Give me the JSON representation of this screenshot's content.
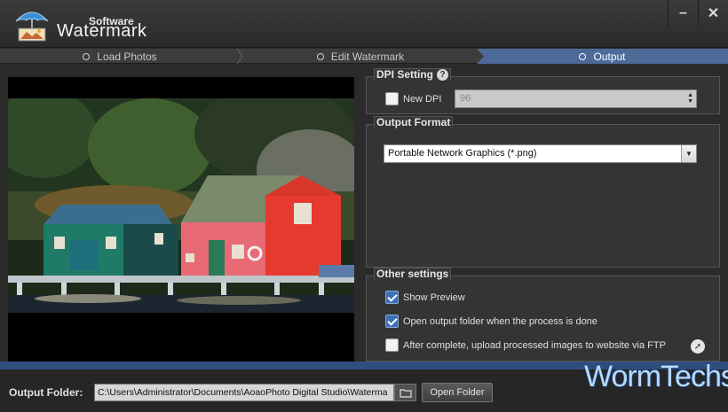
{
  "app": {
    "subtitle": "Software",
    "title": "Watermark"
  },
  "window": {
    "minimize": "–",
    "close": "✕"
  },
  "steps": [
    {
      "label": "Load Photos",
      "active": false
    },
    {
      "label": "Edit Watermark",
      "active": false
    },
    {
      "label": "Output",
      "active": true
    }
  ],
  "dpi": {
    "title": "DPI Setting",
    "help": "?",
    "checkbox_label": "New DPI",
    "checked": false,
    "value": "96"
  },
  "format": {
    "title": "Output Format",
    "selected": "Portable Network Graphics (*.png)"
  },
  "other": {
    "title": "Other settings",
    "options": [
      {
        "label": "Show Preview",
        "checked": true
      },
      {
        "label": "Open output folder when the process is done",
        "checked": true
      },
      {
        "label": "After complete, upload processed images to website via FTP",
        "checked": false
      }
    ]
  },
  "footer": {
    "output_label": "Output Folder:",
    "output_path": "C:\\Users\\Administrator\\Documents\\AoaoPhoto Digital Studio\\Waterma",
    "open_button": "Open Folder"
  },
  "watermark_text": "WormTechs",
  "colors": {
    "active_step": "#4d6a99",
    "accent_bar": "#2f4e7c",
    "checkbox_checked": "#3d6fb8"
  }
}
